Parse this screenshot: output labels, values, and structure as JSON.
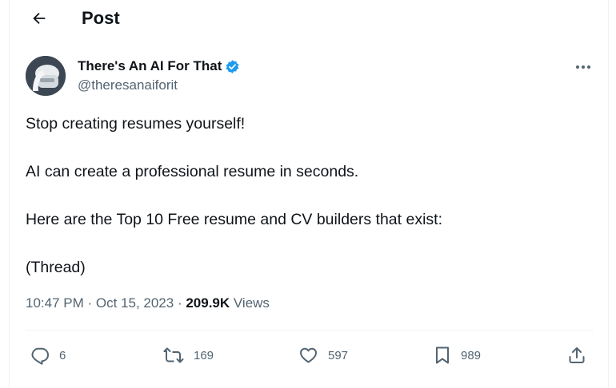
{
  "header": {
    "back_icon": "arrow-left-icon",
    "title": "Post"
  },
  "author": {
    "display_name": "There's An AI For That",
    "verified_icon": "verified-badge-icon",
    "verified_color": "#1d9bf0",
    "handle": "@theresanaiforit"
  },
  "more_icon": "more-horizontal-icon",
  "tweet": {
    "lines": [
      "Stop creating resumes yourself!",
      "AI can create a professional resume in seconds.",
      "Here are the Top 10 Free resume and CV builders that exist:",
      "(Thread)"
    ]
  },
  "meta": {
    "time": "10:47 PM",
    "separator": " · ",
    "date": "Oct 15, 2023",
    "views_count": "209.9K",
    "views_label": "Views"
  },
  "actions": {
    "reply": {
      "icon": "reply-icon",
      "count": "6"
    },
    "repost": {
      "icon": "repost-icon",
      "count": "169"
    },
    "like": {
      "icon": "heart-icon",
      "count": "597"
    },
    "bookmark": {
      "icon": "bookmark-icon",
      "count": "989"
    },
    "share": {
      "icon": "share-icon"
    }
  },
  "colors": {
    "text": "#0f1419",
    "secondary": "#536471",
    "divider": "#eff3f4"
  }
}
